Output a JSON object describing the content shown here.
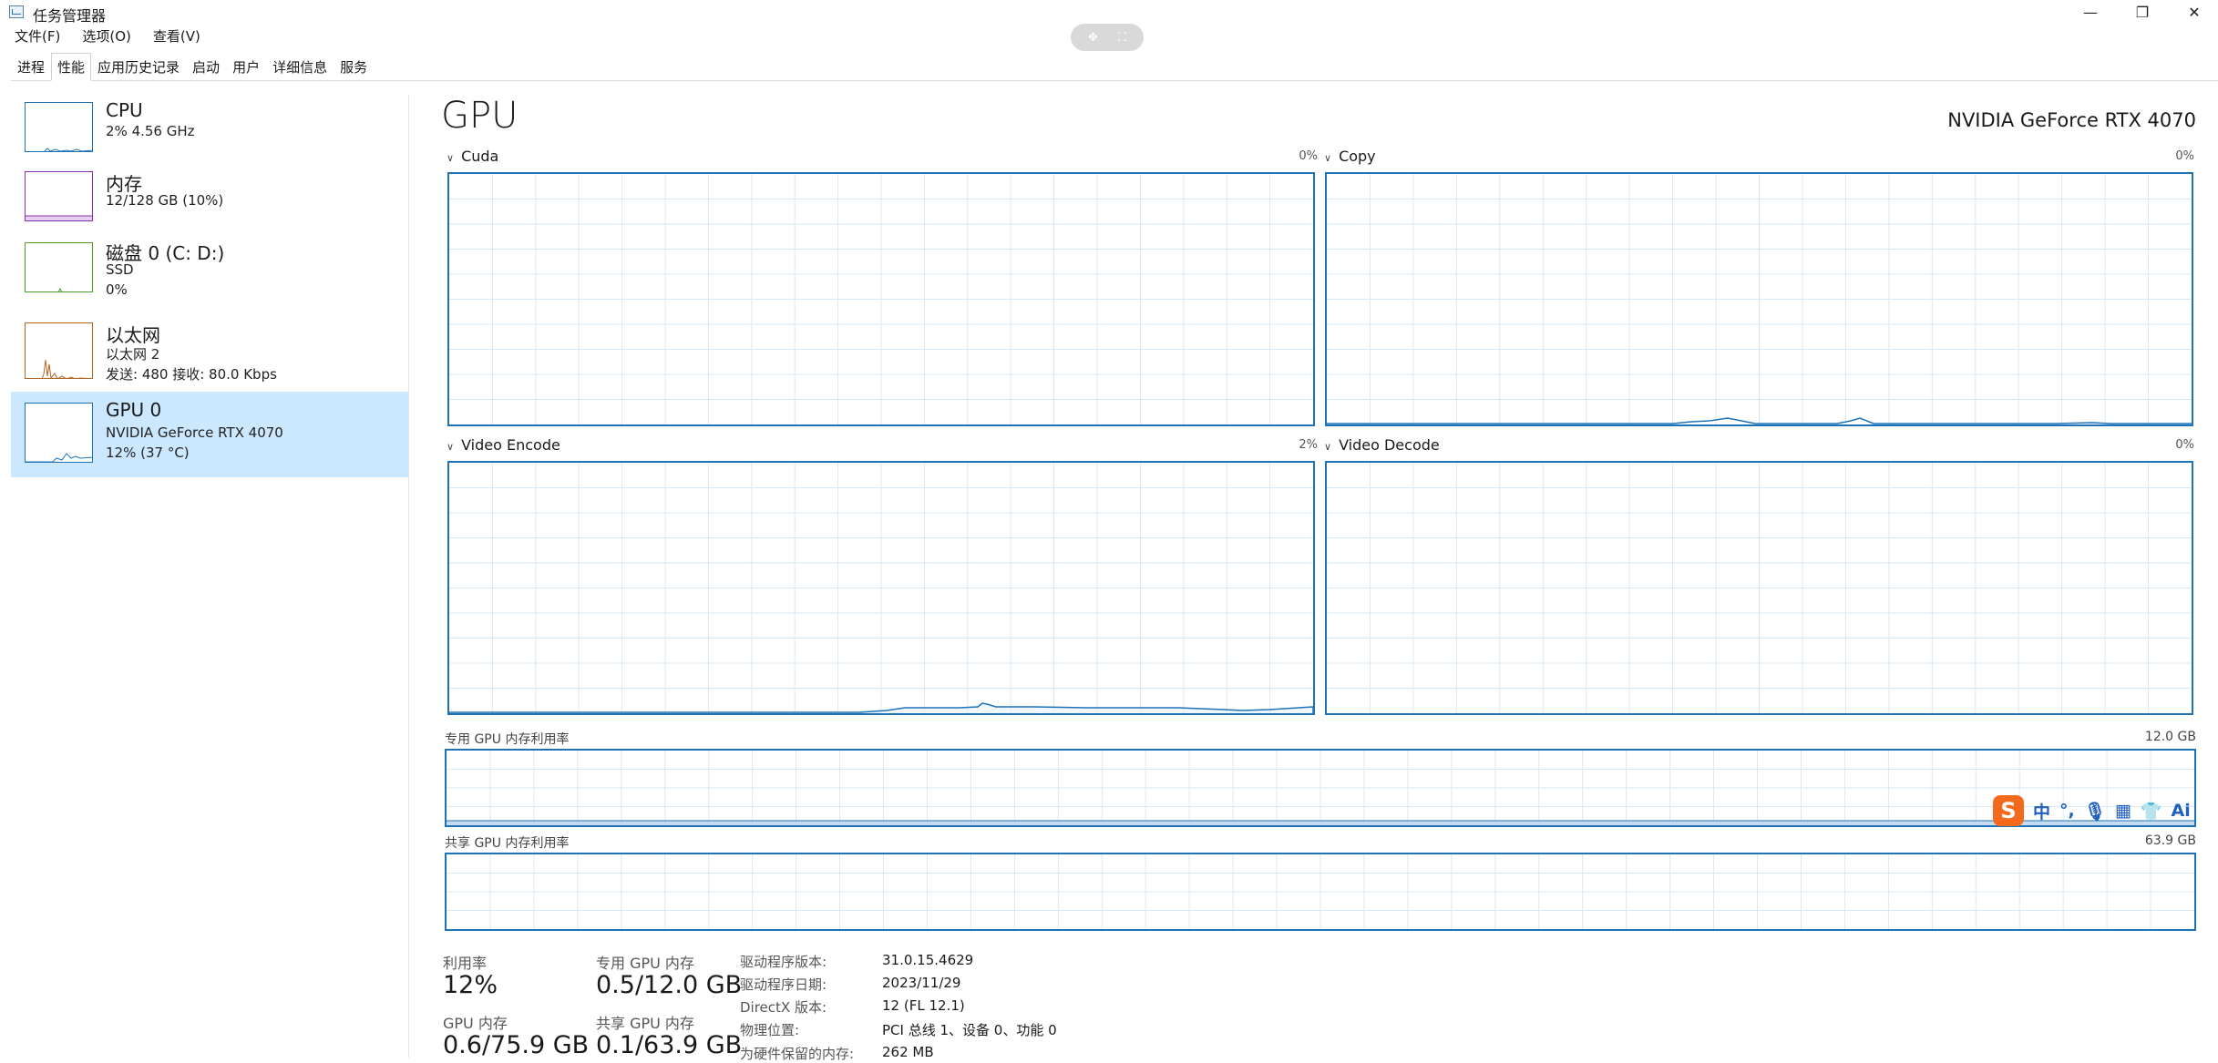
{
  "window": {
    "title": "任务管理器",
    "minimize": "—",
    "maximize": "❐",
    "close": "✕"
  },
  "menu": [
    "文件(F)",
    "选项(O)",
    "查看(V)"
  ],
  "tabs": [
    "进程",
    "性能",
    "应用历史记录",
    "启动",
    "用户",
    "详细信息",
    "服务"
  ],
  "active_tab": "性能",
  "sidebar": {
    "items": [
      {
        "title": "CPU",
        "sub1": "2% 4.56 GHz",
        "sub2": ""
      },
      {
        "title": "内存",
        "sub1": "12/128 GB (10%)",
        "sub2": ""
      },
      {
        "title": "磁盘 0 (C: D:)",
        "sub1": "SSD",
        "sub2": "0%"
      },
      {
        "title": "以太网",
        "sub1": "以太网 2",
        "sub2": "发送: 480  接收: 80.0 Kbps"
      },
      {
        "title": "GPU 0",
        "sub1": "NVIDIA GeForce RTX 4070",
        "sub2": "12% (37 °C)"
      }
    ],
    "colors": {
      "cpu": "#1e72b8",
      "memory": "#8b2fa8",
      "disk": "#4a9e26",
      "ethernet": "#b5651d",
      "gpu": "#1e72b8",
      "selected_bg": "#cce8ff"
    }
  },
  "main": {
    "title": "GPU",
    "model": "NVIDIA GeForce RTX 4070",
    "engines": [
      {
        "name": "Cuda",
        "pct": "0%"
      },
      {
        "name": "Copy",
        "pct": "0%"
      },
      {
        "name": "Video Encode",
        "pct": "2%"
      },
      {
        "name": "Video Decode",
        "pct": "0%"
      }
    ],
    "dedicated_mem_label": "专用 GPU 内存利用率",
    "dedicated_mem_max": "12.0 GB",
    "shared_mem_label": "共享 GPU 内存利用率",
    "shared_mem_max": "63.9 GB",
    "stats": {
      "utilization_label": "利用率",
      "utilization_value": "12%",
      "dedicated_label": "专用 GPU 内存",
      "dedicated_value": "0.5/12.0 GB",
      "gpu_mem_label": "GPU 内存",
      "gpu_mem_value": "0.6/75.9 GB",
      "shared_label": "共享 GPU 内存",
      "shared_value": "0.1/63.9 GB"
    },
    "details": [
      {
        "label": "驱动程序版本:",
        "value": "31.0.15.4629"
      },
      {
        "label": "驱动程序日期:",
        "value": "2023/11/29"
      },
      {
        "label": "DirectX 版本:",
        "value": "12 (FL 12.1)"
      },
      {
        "label": "物理位置:",
        "value": "PCI 总线 1、设备 0、功能 0"
      },
      {
        "label": "为硬件保留的内存:",
        "value": "262 MB"
      }
    ]
  },
  "ime": {
    "logo": "S",
    "lang": "中",
    "ai": "Ai"
  },
  "accent": "#1e72b8"
}
